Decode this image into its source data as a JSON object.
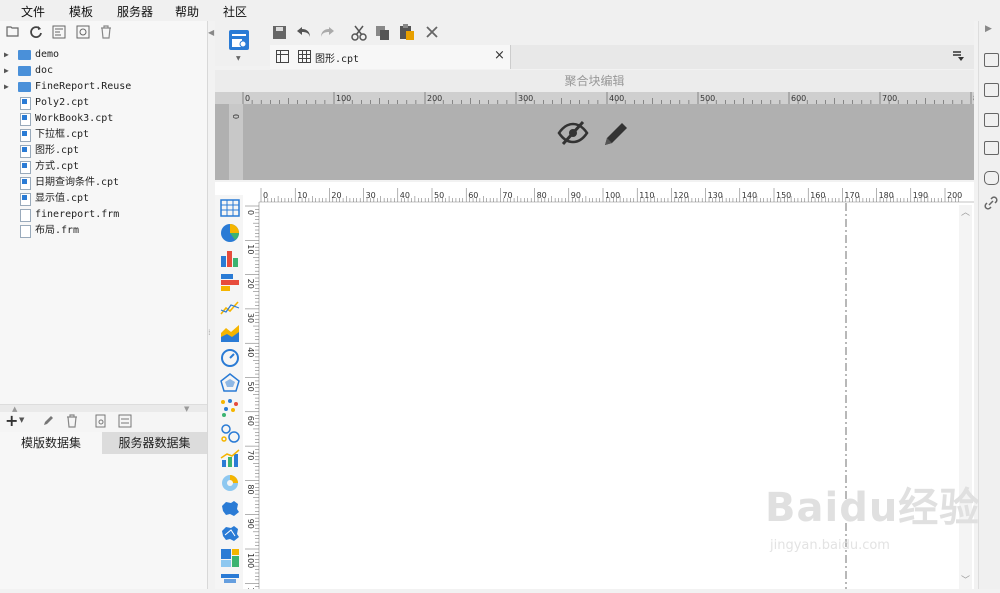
{
  "menubar": {
    "items": [
      "文件",
      "模板",
      "服务器",
      "帮助",
      "社区"
    ]
  },
  "tree": {
    "items": [
      {
        "label": "demo",
        "type": "folder"
      },
      {
        "label": "doc",
        "type": "folder"
      },
      {
        "label": "FineReport.Reuse",
        "type": "folder"
      },
      {
        "label": "Poly2.cpt",
        "type": "cpt"
      },
      {
        "label": "WorkBook3.cpt",
        "type": "cpt"
      },
      {
        "label": "下拉框.cpt",
        "type": "cpt"
      },
      {
        "label": "图形.cpt",
        "type": "cpt"
      },
      {
        "label": "方式.cpt",
        "type": "cpt"
      },
      {
        "label": "日期查询条件.cpt",
        "type": "cpt"
      },
      {
        "label": "显示值.cpt",
        "type": "cpt"
      },
      {
        "label": "finereport.frm",
        "type": "frm"
      },
      {
        "label": "布局.frm",
        "type": "frm"
      }
    ]
  },
  "datasets": {
    "tab_template": "模版数据集",
    "tab_server": "服务器数据集"
  },
  "editor": {
    "doc_tab_label": "图形.cpt",
    "block_title": "聚合块编辑"
  },
  "ruler_top_preview": [
    "0",
    "100",
    "200",
    "300",
    "400",
    "500",
    "600",
    "700",
    "80"
  ],
  "ruler_top_canvas": [
    "0",
    "10",
    "20",
    "30",
    "40",
    "50",
    "60",
    "70",
    "80",
    "90",
    "100",
    "110",
    "120",
    "130",
    "140",
    "150",
    "160",
    "170",
    "180",
    "190",
    "200"
  ],
  "ruler_left_canvas": [
    "0",
    "10",
    "20",
    "30",
    "40",
    "50",
    "60",
    "70",
    "80",
    "90",
    "100",
    "10"
  ],
  "watermark": {
    "brand": "Baidu经验",
    "url": "jingyan.baidu.com"
  },
  "colors": {
    "folder": "#4a90d9",
    "preview_bg": "#b0b0b0",
    "guide_line": "#888888"
  }
}
